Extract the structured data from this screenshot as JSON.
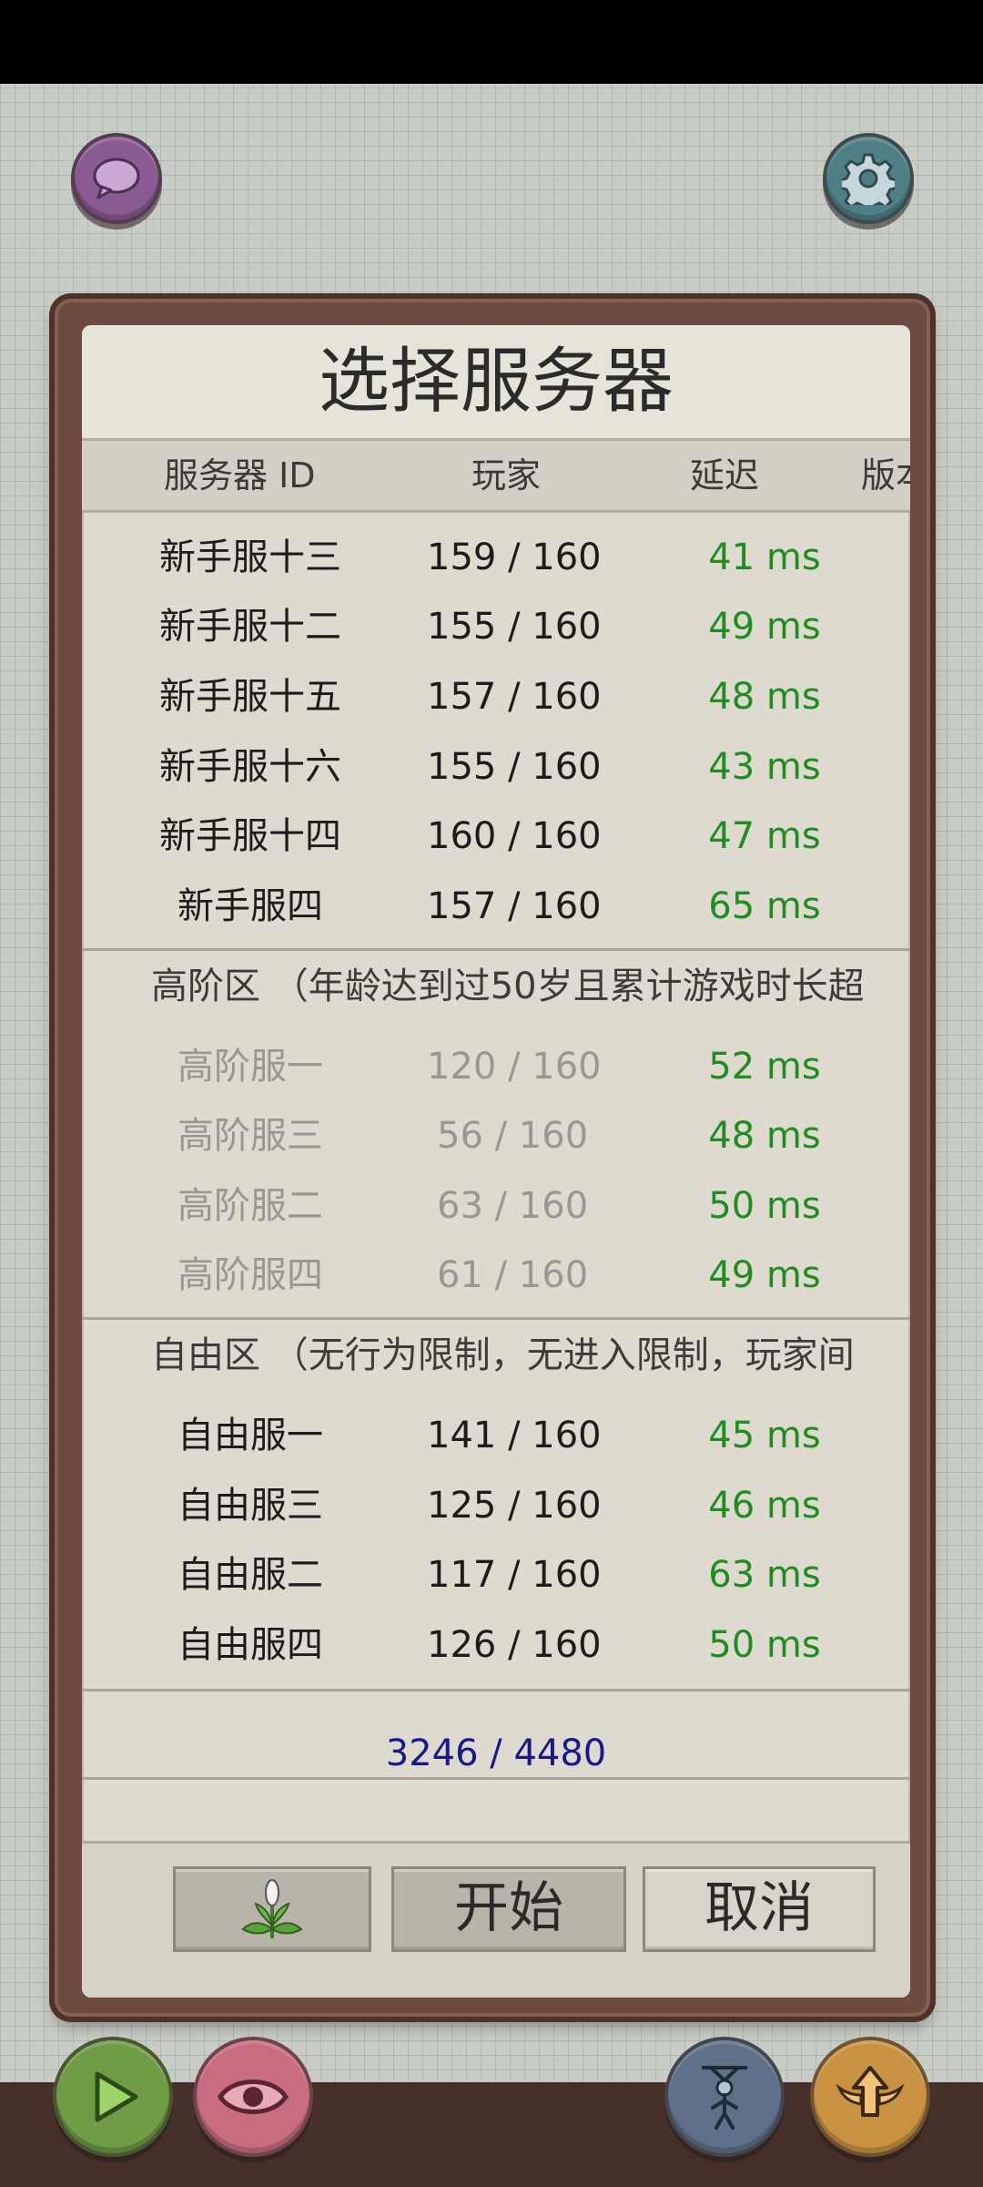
{
  "dialog": {
    "title": "选择服务器",
    "columns": {
      "server_id": "服务器 ID",
      "players": "玩家",
      "latency": "延迟",
      "version": "版本"
    }
  },
  "sections": [
    {
      "title": "",
      "servers": [
        {
          "name": "新手服十三",
          "players": "159 / 160",
          "latency": "41 ms"
        },
        {
          "name": "新手服十二",
          "players": "155 / 160",
          "latency": "49 ms"
        },
        {
          "name": "新手服十五",
          "players": "157 / 160",
          "latency": "48 ms"
        },
        {
          "name": "新手服十六",
          "players": "155 / 160",
          "latency": "43 ms"
        },
        {
          "name": "新手服十四",
          "players": "160 / 160",
          "latency": "47 ms"
        },
        {
          "name": "新手服四",
          "players": "157 / 160",
          "latency": "65 ms"
        }
      ]
    },
    {
      "title": "高阶区 （年龄达到过50岁且累计游戏时长超",
      "servers": [
        {
          "name": "高阶服一",
          "players": "120 / 160",
          "latency": "52 ms"
        },
        {
          "name": "高阶服三",
          "players": "56 / 160",
          "latency": "48 ms"
        },
        {
          "name": "高阶服二",
          "players": "63 / 160",
          "latency": "50 ms"
        },
        {
          "name": "高阶服四",
          "players": "61 / 160",
          "latency": "49 ms"
        }
      ]
    },
    {
      "title": "自由区 （无行为限制，无进入限制，玩家间",
      "servers": [
        {
          "name": "自由服一",
          "players": "141 / 160",
          "latency": "45 ms"
        },
        {
          "name": "自由服三",
          "players": "125 / 160",
          "latency": "46 ms"
        },
        {
          "name": "自由服二",
          "players": "117 / 160",
          "latency": "63 ms"
        },
        {
          "name": "自由服四",
          "players": "126 / 160",
          "latency": "50 ms"
        }
      ]
    }
  ],
  "total": "3246 / 4480",
  "buttons": {
    "start": "开始",
    "cancel": "取消"
  },
  "icons": {
    "chat": "chat-bubble-icon",
    "settings": "gear-icon",
    "plant": "flower-sprout-icon",
    "play": "play-icon",
    "eye": "eye-icon",
    "puppet": "puppet-figure-icon",
    "upgrade": "winged-arrow-up-icon"
  },
  "colors": {
    "latency": "#1f8d1f",
    "total": "#18188a",
    "dim_text": "#9a9791",
    "frame": "#6d4b40",
    "panel": "#dedad0"
  }
}
